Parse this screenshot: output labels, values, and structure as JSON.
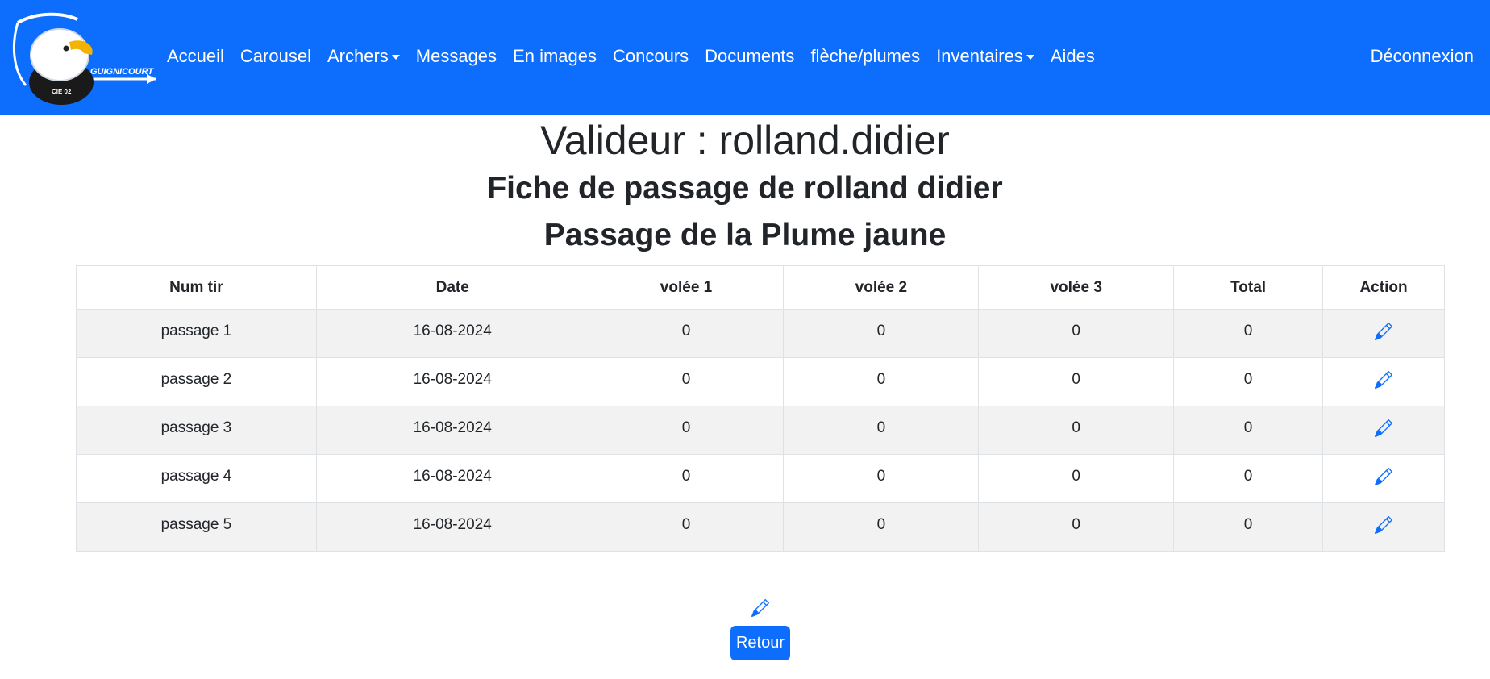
{
  "nav": {
    "logo_text": "GUIGNICOURT",
    "logo_subtext": "CIE 02",
    "items": [
      {
        "label": "Accueil",
        "dropdown": false
      },
      {
        "label": "Carousel",
        "dropdown": false
      },
      {
        "label": "Archers",
        "dropdown": true
      },
      {
        "label": "Messages",
        "dropdown": false
      },
      {
        "label": "En images",
        "dropdown": false
      },
      {
        "label": "Concours",
        "dropdown": false
      },
      {
        "label": "Documents",
        "dropdown": false
      },
      {
        "label": "flèche/plumes",
        "dropdown": false
      },
      {
        "label": "Inventaires",
        "dropdown": true
      },
      {
        "label": "Aides",
        "dropdown": false
      }
    ],
    "logout": "Déconnexion"
  },
  "page": {
    "validator": "Valideur : rolland.didier",
    "sheet_title": "Fiche de passage de rolland didier",
    "level_title": "Passage de la Plume jaune"
  },
  "table": {
    "headers": [
      "Num tir",
      "Date",
      "volée 1",
      "volée 2",
      "volée 3",
      "Total",
      "Action"
    ],
    "rows": [
      [
        "passage 1",
        "16-08-2024",
        "0",
        "0",
        "0",
        "0"
      ],
      [
        "passage 2",
        "16-08-2024",
        "0",
        "0",
        "0",
        "0"
      ],
      [
        "passage 3",
        "16-08-2024",
        "0",
        "0",
        "0",
        "0"
      ],
      [
        "passage 4",
        "16-08-2024",
        "0",
        "0",
        "0",
        "0"
      ],
      [
        "passage 5",
        "16-08-2024",
        "0",
        "0",
        "0",
        "0"
      ]
    ],
    "action_icon": "pencil-icon"
  },
  "footer": {
    "edit_icon": "pencil-icon",
    "back_label": "Retour"
  },
  "colors": {
    "navbar": "#0d6efd",
    "accent": "#0d6efd",
    "stripe": "#f2f2f2"
  }
}
